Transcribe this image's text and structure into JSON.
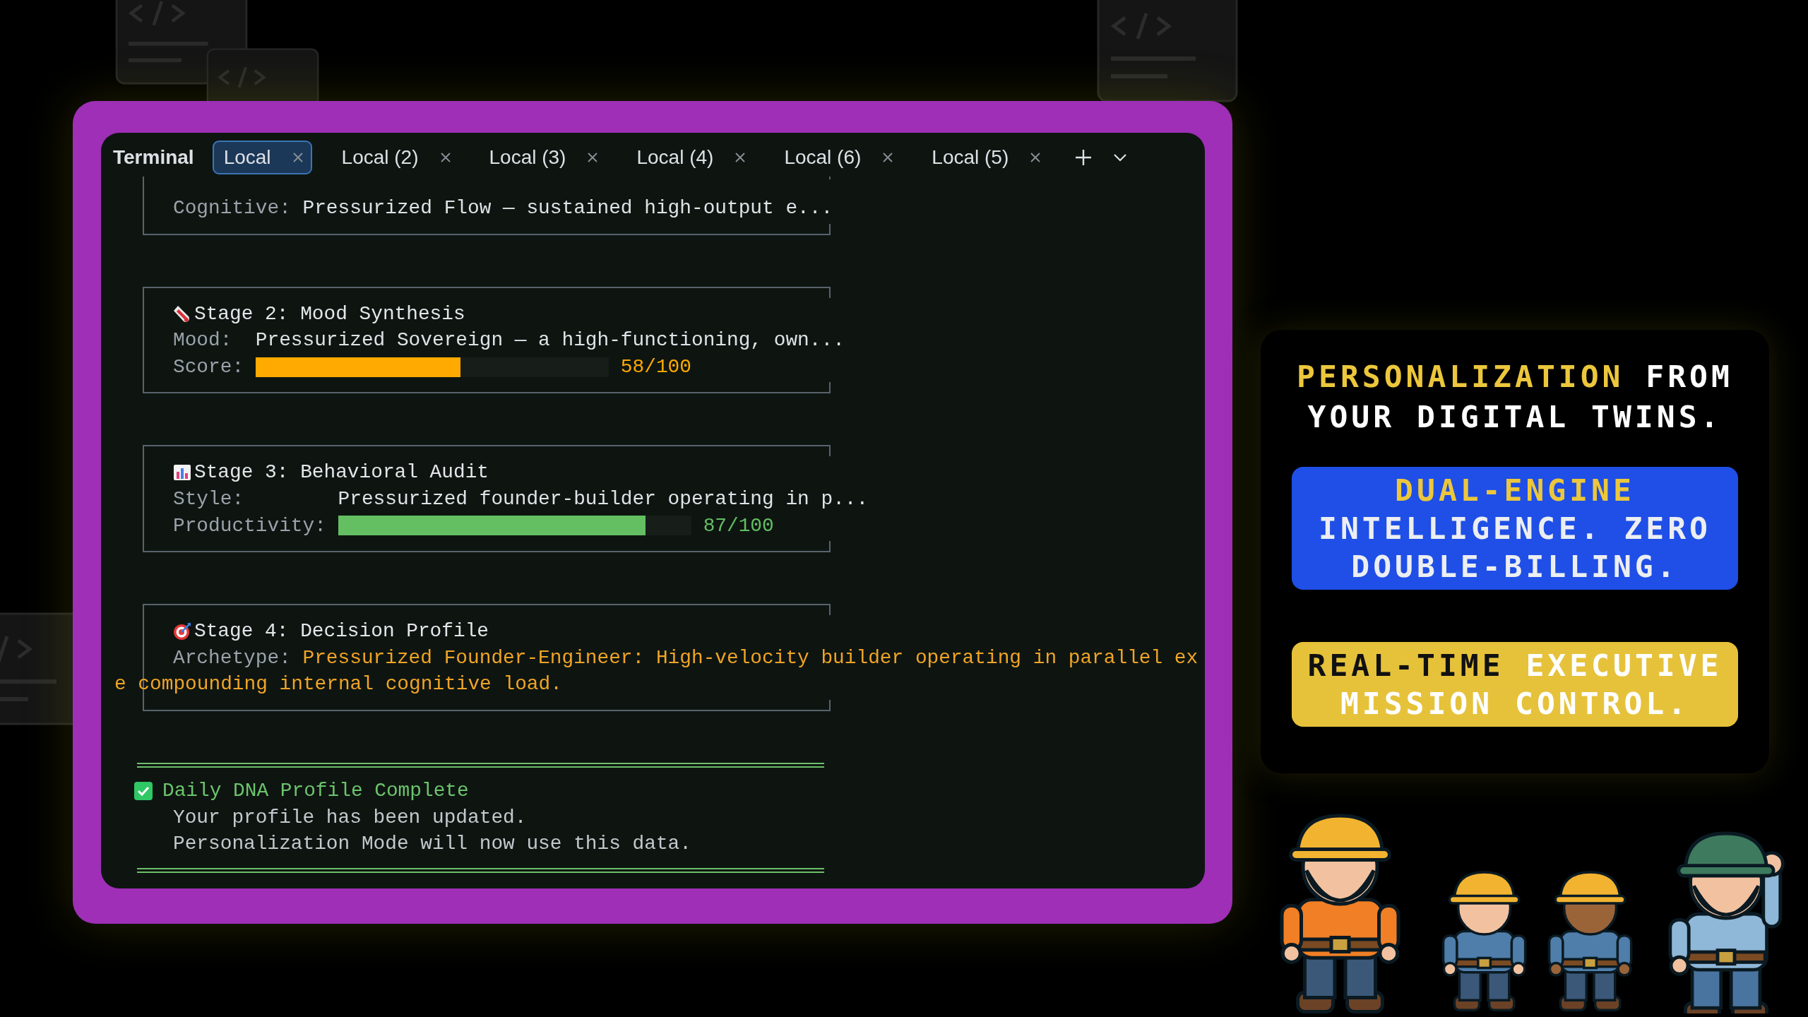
{
  "terminal": {
    "title": "Terminal",
    "tabs": [
      {
        "label": "Local",
        "selected": true
      },
      {
        "label": "Local (2)",
        "selected": false
      },
      {
        "label": "Local (3)",
        "selected": false
      },
      {
        "label": "Local (4)",
        "selected": false
      },
      {
        "label": "Local (6)",
        "selected": false
      },
      {
        "label": "Local (5)",
        "selected": false
      }
    ],
    "stages": [
      {
        "rows": [
          {
            "kind": "text",
            "label": "Cognitive:",
            "value": "Pressurized Flow — sustained high-output e...",
            "emphasis": false
          }
        ]
      },
      {
        "title": "Stage 2: Mood Synthesis",
        "rows": [
          {
            "kind": "text",
            "label": "Mood:",
            "value": "Pressurized Sovereign — a high-functioning, own...",
            "emphasis": false
          },
          {
            "kind": "meter",
            "label": "Score:",
            "level": 0.58,
            "reading": "58/100",
            "color": "#ffaa00"
          }
        ]
      },
      {
        "title": "Stage 3: Behavioral Audit",
        "rows": [
          {
            "kind": "text",
            "label": "Style:",
            "value": "Pressurized founder-builder operating in p...",
            "emphasis": false
          },
          {
            "kind": "meter",
            "label": "Productivity:",
            "level": 0.87,
            "reading": "87/100",
            "color": "#63bf62"
          }
        ]
      },
      {
        "title": "Stage 4: Decision Profile",
        "rows": [
          {
            "kind": "text",
            "label": "Archetype:",
            "value": "Pressurized Founder-Engineer: High-velocity builder operating in parallel ex",
            "continuation": "e compounding internal cognitive load.",
            "emphasis": true
          }
        ]
      }
    ],
    "completion": {
      "checked": true,
      "title": "Daily DNA Profile Complete",
      "lines": [
        "Your profile has been updated.",
        "Personalization Mode will now use this data."
      ]
    }
  },
  "promo": {
    "headline": {
      "accent": "PERSONALIZATION",
      "text": "FROM YOUR DIGITAL TWINS."
    },
    "badges": [
      {
        "kind": "primary",
        "accent": "DUAL-ENGINE",
        "text": "INTELLIGENCE. ZERO DOUBLE-BILLING."
      },
      {
        "kind": "highlight",
        "accent": "REAL-TIME",
        "text": "EXECUTIVE MISSION CONTROL."
      }
    ]
  }
}
